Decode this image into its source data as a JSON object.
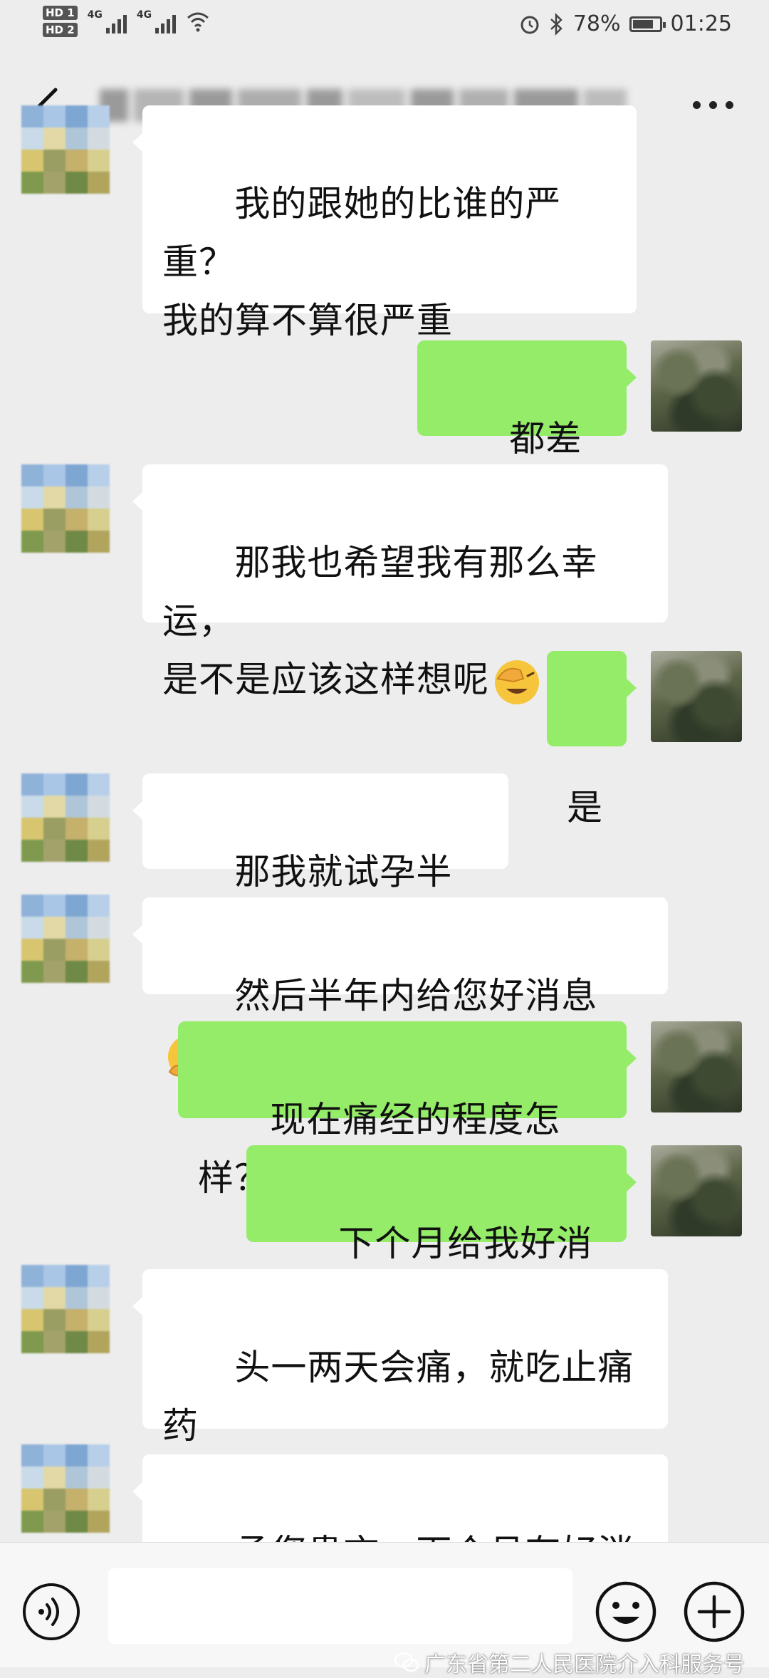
{
  "status_bar": {
    "hd1": "HD 1",
    "hd2": "HD 2",
    "net1": "4G",
    "net2": "4G",
    "battery": "78%",
    "battery_level": 0.78,
    "time": "01:25",
    "icons": [
      "signal-icon",
      "wifi-icon",
      "alarm-icon",
      "bluetooth-icon",
      "battery-icon"
    ]
  },
  "header": {
    "back_icon": "chevron-left-icon",
    "title": "",
    "more_icon": "more-dots-icon"
  },
  "messages": [
    {
      "side": "left",
      "text": "我的跟她的比谁的严重？\n我的算不算很严重"
    },
    {
      "side": "right",
      "text": "都差不多"
    },
    {
      "side": "left",
      "text": "那我也希望我有那么幸运，\n是不是应该这样想呢",
      "emoji": "face-palm-emoji"
    },
    {
      "side": "right",
      "text": "是"
    },
    {
      "side": "left",
      "text": "那我就试孕半年？"
    },
    {
      "side": "left",
      "text": "然后半年内给您好消息",
      "emoji": "thinking-emoji"
    },
    {
      "side": "right",
      "text": "现在痛经的程度怎样？"
    },
    {
      "side": "right",
      "text": "下个月给我好消息"
    },
    {
      "side": "left",
      "text": "头一两天会痛，就吃止痛\n药"
    },
    {
      "side": "left",
      "text": "承您贵言，下个月有好消"
    }
  ],
  "bottom_bar": {
    "voice_icon": "voice-icon",
    "input_value": "",
    "emoji_icon": "smile-icon",
    "plus_icon": "plus-icon"
  },
  "watermark": {
    "text": "广东省第二人民医院介入科服务号",
    "icon": "wechat-icon"
  },
  "colors": {
    "background": "#ededed",
    "bubble_self": "#95ec69",
    "bubble_other": "#ffffff"
  }
}
